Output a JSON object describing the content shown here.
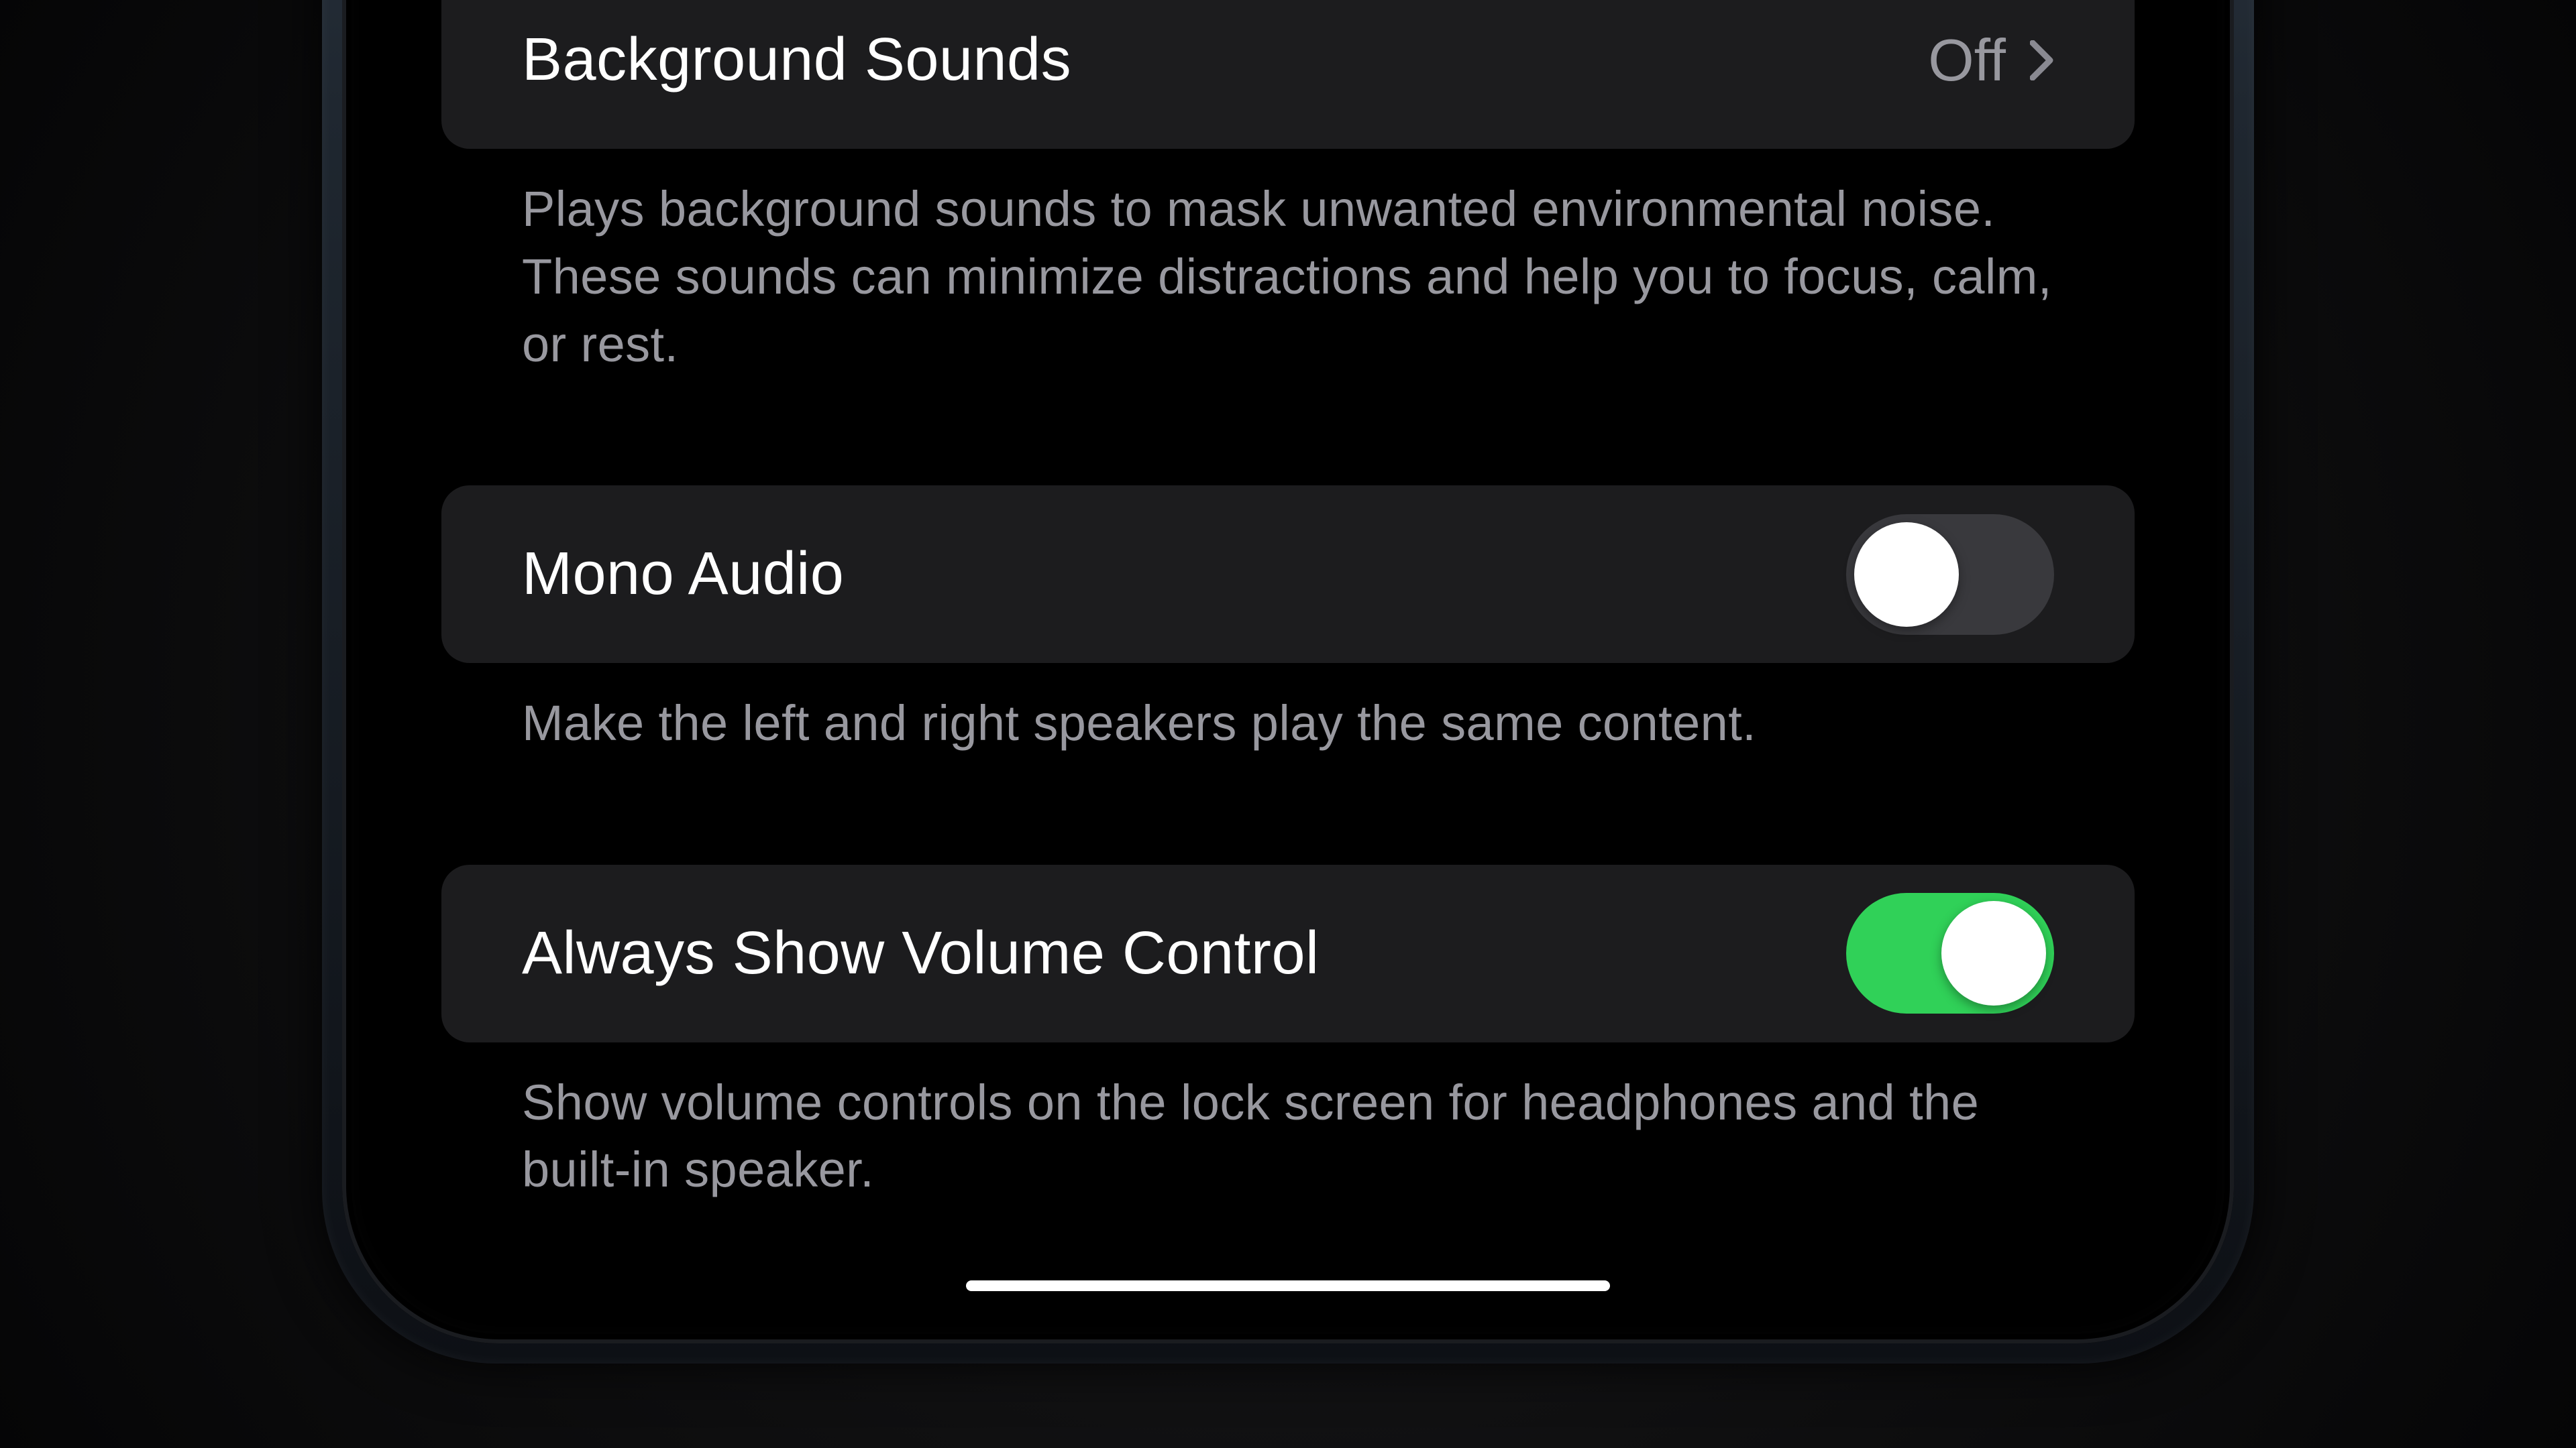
{
  "sections": {
    "background_sounds": {
      "label": "Background Sounds",
      "value": "Off",
      "footer": "Plays background sounds to mask unwanted environmental noise. These sounds can minimize distractions and help you to focus, calm, or rest."
    },
    "mono_audio": {
      "label": "Mono Audio",
      "state": "off",
      "footer": "Make the left and right speakers play the same content."
    },
    "always_show_volume": {
      "label": "Always Show Volume Control",
      "state": "on",
      "footer": "Show volume controls on the lock screen for headphones and the built-in speaker."
    }
  }
}
